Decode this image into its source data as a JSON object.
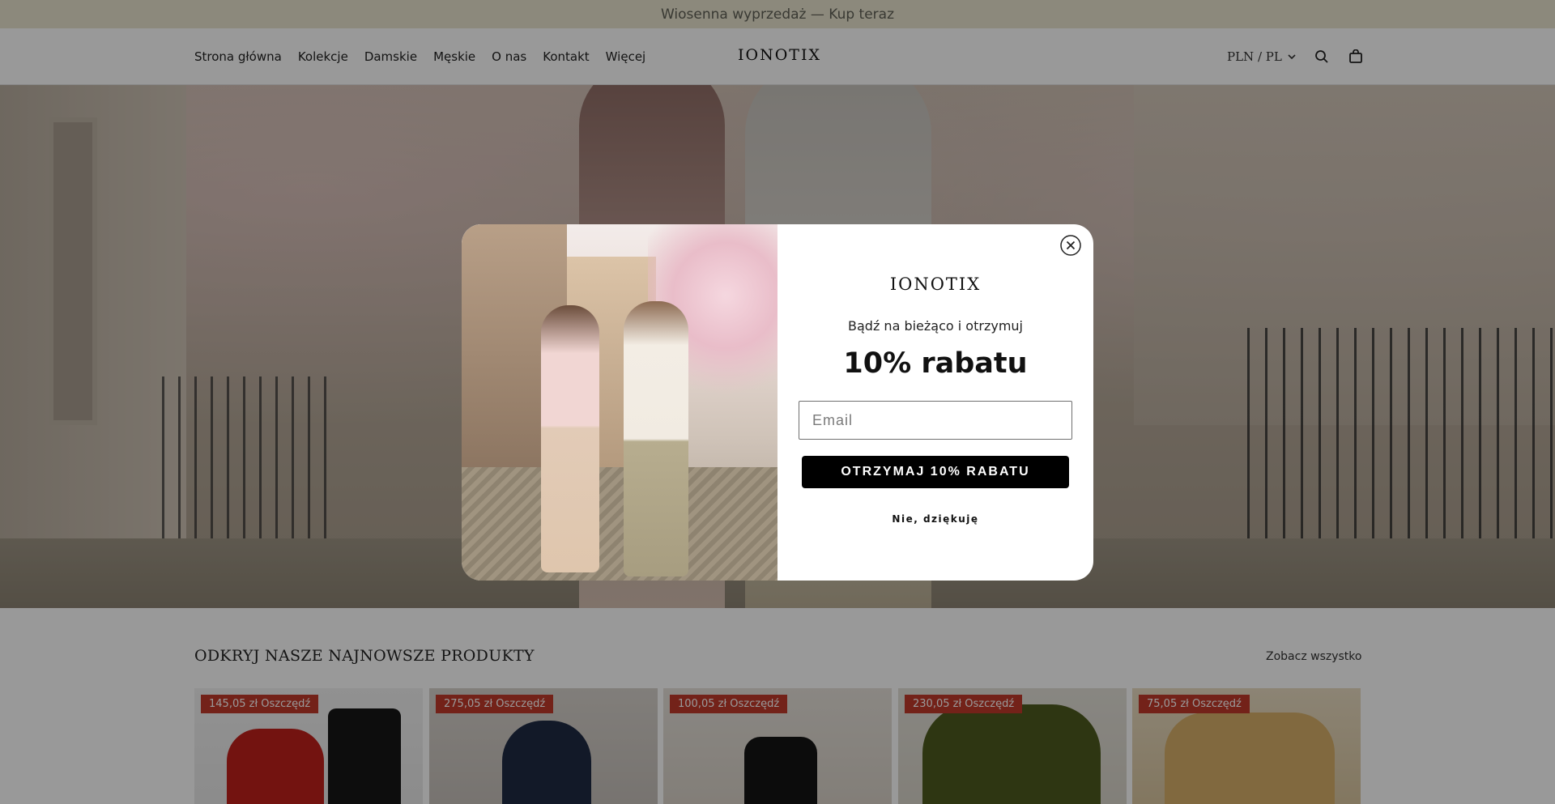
{
  "announcement": {
    "text": "Wiosenna wyprzedaż — Kup teraz"
  },
  "header": {
    "nav": [
      "Strona główna",
      "Kolekcje",
      "Damskie",
      "Męskie",
      "O nas",
      "Kontakt",
      "Więcej"
    ],
    "logo": "IONOTIX",
    "locale": "PLN / PL",
    "icons": [
      "chevron-down-icon",
      "search-icon",
      "cart-icon"
    ]
  },
  "section": {
    "title": "ODKRYJ NASZE NAJNOWSZE PRODUKTY",
    "view_all": "Zobacz wszystko",
    "products": [
      {
        "badge": "145,05 zł Oszczędź"
      },
      {
        "badge": "275,05 zł Oszczędź"
      },
      {
        "badge": "100,05 zł Oszczędź"
      },
      {
        "badge": "230,05 zł Oszczędź"
      },
      {
        "badge": "75,05 zł Oszczędź"
      }
    ]
  },
  "popup": {
    "logo": "IONOTIX",
    "subtitle": "Bądź na bieżąco i otrzymuj",
    "offer": "10% rabatu",
    "email_placeholder": "Email",
    "submit_label": "OTRZYMAJ 10% RABATU",
    "decline_label": "Nie, dziękuję"
  },
  "colors": {
    "announcement_bg": "#e9e5cf",
    "badge": "#c0392b",
    "button": "#000000"
  }
}
